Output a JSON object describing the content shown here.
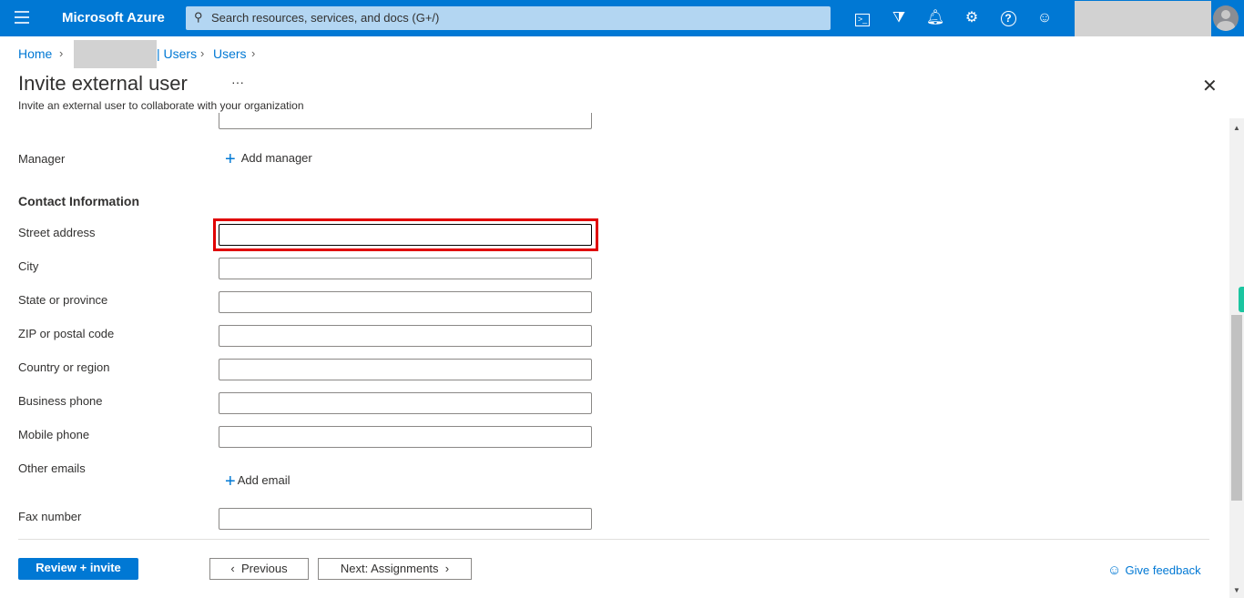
{
  "header": {
    "brand": "Microsoft Azure",
    "search_placeholder": "Search resources, services, and docs (G+/)"
  },
  "icons": [
    "cloud-shell-icon",
    "directory-filter-icon",
    "bell-icon",
    "gear-icon",
    "help-icon",
    "feedback-icon"
  ],
  "breadcrumb": {
    "home": "Home",
    "tenant_suffix": "| Users",
    "users": "Users"
  },
  "page": {
    "title": "Invite external user",
    "more": "···",
    "subtitle": "Invite an external user to collaborate with your organization",
    "close": "✕"
  },
  "form": {
    "manager_label": "Manager",
    "add_manager": "Add manager",
    "contact_heading": "Contact Information",
    "fields": [
      {
        "label": "Street address",
        "value": ""
      },
      {
        "label": "City",
        "value": ""
      },
      {
        "label": "State or province",
        "value": ""
      },
      {
        "label": "ZIP or postal code",
        "value": ""
      },
      {
        "label": "Country or region",
        "value": ""
      },
      {
        "label": "Business phone",
        "value": ""
      },
      {
        "label": "Mobile phone",
        "value": ""
      }
    ],
    "other_emails_label": "Other emails",
    "add_email": "Add email",
    "fax_label": "Fax number",
    "fax_value": ""
  },
  "footer": {
    "review": "Review + invite",
    "previous": "Previous",
    "next": "Next: Assignments",
    "feedback": "Give feedback"
  },
  "colors": {
    "accent": "#0078d4",
    "highlight": "#e00000"
  }
}
